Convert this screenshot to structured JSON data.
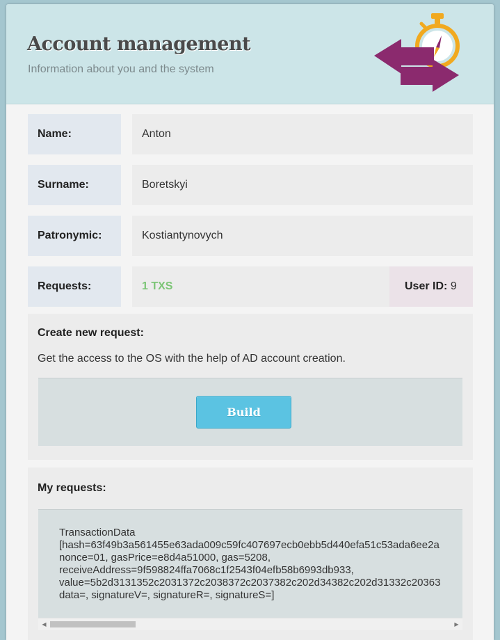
{
  "header": {
    "title": "Account management",
    "subtitle": "Information about you and the system",
    "logo_icon": "exchange-stopwatch-icon"
  },
  "profile": {
    "name_label": "Name:",
    "name_value": "Anton",
    "surname_label": "Surname:",
    "surname_value": "Boretskyi",
    "patronymic_label": "Patronymic:",
    "patronymic_value": "Kostiantynovych",
    "requests_label": "Requests:",
    "requests_value": "1 TXS",
    "user_id_label": "User ID:",
    "user_id_value": "9"
  },
  "create_request": {
    "title": "Create new request:",
    "description": "Get the access to the OS with the help of AD account creation.",
    "build_label": "Build"
  },
  "my_requests": {
    "title": "My requests:",
    "lines": [
      "TransactionData",
      "[hash=63f49b3a561455e63ada009c59fc407697ecb0ebb5d440efa51c53ada6ee2a",
      "nonce=01, gasPrice=e8d4a51000, gas=5208,",
      "receiveAddress=9f598824ffa7068c1f2543f04efb58b6993db933,",
      "value=5b2d3131352c2031372c2038372c2037382c202d34382c202d31332c20363",
      "data=, signatureV=, signatureR=, signatureS=]"
    ]
  },
  "colors": {
    "background": "#a4c6cf",
    "header": "#cce5e8",
    "accent_blue": "#5bc3e2",
    "txs_green": "#7cc576",
    "logo_purple": "#8b2a6e",
    "logo_orange": "#f1a91f"
  }
}
